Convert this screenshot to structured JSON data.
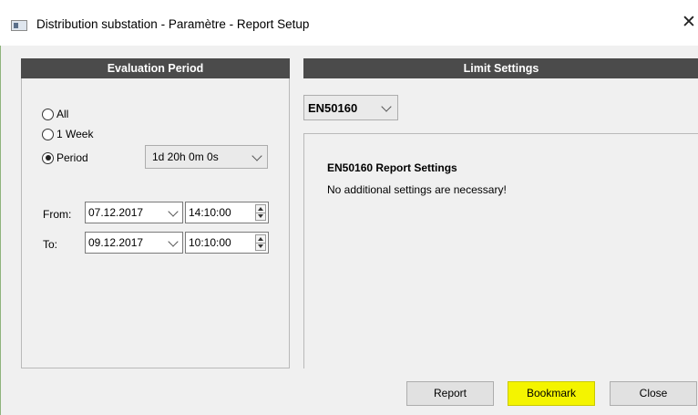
{
  "window": {
    "title": "Distribution substation - Paramètre - Report Setup"
  },
  "left_panel": {
    "header": "Evaluation Period",
    "radios": [
      {
        "label": "All",
        "selected": false
      },
      {
        "label": "1 Week",
        "selected": false
      },
      {
        "label": "Period",
        "selected": true
      }
    ],
    "period_value": "1d 20h 0m 0s",
    "from_label": "From:",
    "from_date": "07.12.2017",
    "from_time": "14:10:00",
    "to_label": "To:",
    "to_date": "09.12.2017",
    "to_time": "10:10:00"
  },
  "right_panel": {
    "header": "Limit Settings",
    "standard": "EN50160",
    "settings_title": "EN50160 Report Settings",
    "settings_text": "No additional settings are necessary!"
  },
  "buttons": {
    "report": "Report",
    "bookmark": "Bookmark",
    "close": "Close"
  },
  "colors": {
    "header_bg": "#4b4b4b",
    "bookmark_highlight": "#f4f400"
  }
}
